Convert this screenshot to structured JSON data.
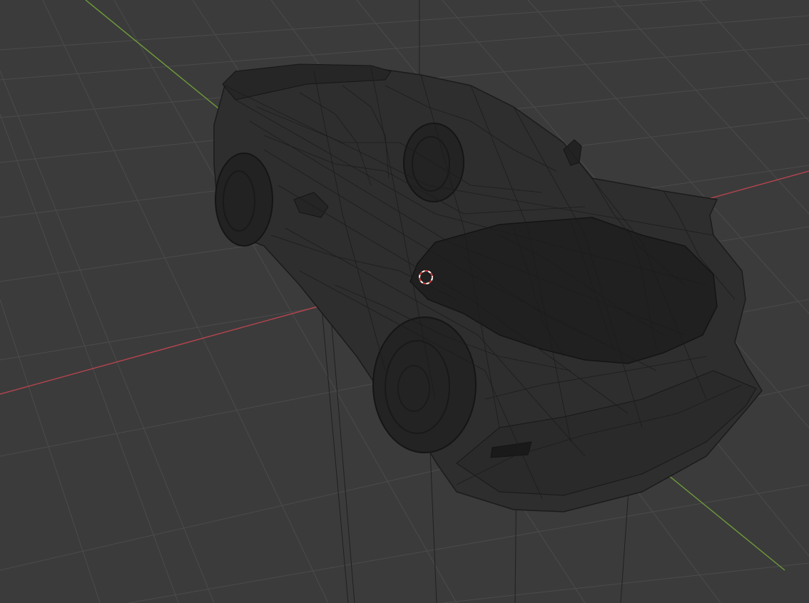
{
  "viewport": {
    "mode": "wireframe-3d-viewport",
    "background_color": "#3b3b3b",
    "grid_color": "#4d4d4d",
    "x_axis_color": "#b8444f",
    "y_axis_color": "#6f9a3a",
    "object": "sports-car-wireframe-model",
    "cursor": "3d-cursor"
  }
}
